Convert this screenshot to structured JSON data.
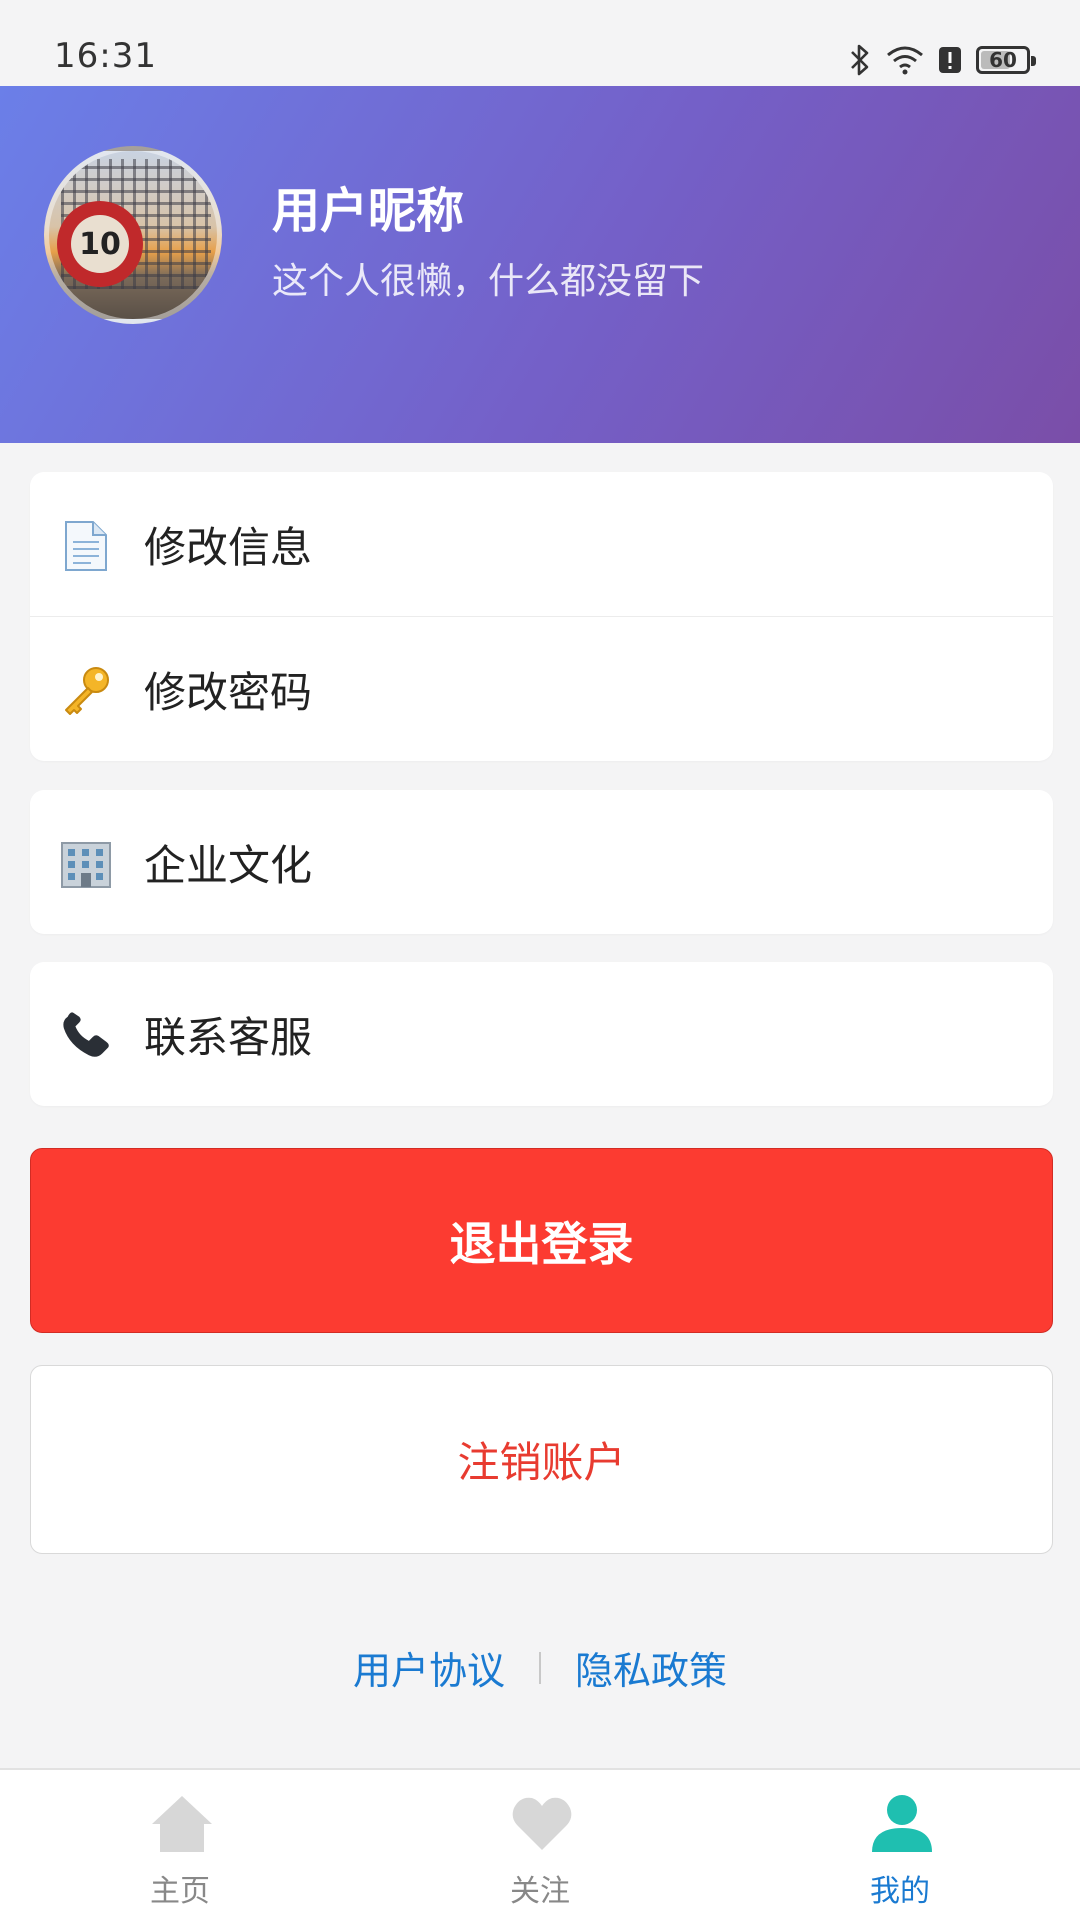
{
  "status_bar": {
    "time": "16:31",
    "battery": "60"
  },
  "profile": {
    "nickname": "用户昵称",
    "bio": "这个人很懒，什么都没留下",
    "avatar_sign_text": "10"
  },
  "menu": {
    "group1": [
      {
        "label": "修改信息",
        "icon": "document-icon"
      },
      {
        "label": "修改密码",
        "icon": "key-icon"
      }
    ],
    "group2": [
      {
        "label": "企业文化",
        "icon": "building-icon"
      }
    ],
    "group3": [
      {
        "label": "联系客服",
        "icon": "phone-icon"
      }
    ]
  },
  "actions": {
    "logout": "退出登录",
    "cancel_account": "注销账户"
  },
  "legal": {
    "user_agreement": "用户协议",
    "privacy_policy": "隐私政策"
  },
  "tabbar": {
    "tabs": [
      {
        "label": "主页",
        "icon": "home-icon",
        "active": false
      },
      {
        "label": "关注",
        "icon": "heart-icon",
        "active": false
      },
      {
        "label": "我的",
        "icon": "person-icon",
        "active": true
      }
    ]
  },
  "colors": {
    "header_start": "#6b7fe8",
    "header_end": "#7a4ea8",
    "logout_bg": "#fc3b31",
    "danger_text": "#e83b30",
    "link": "#1a7ad1",
    "active_tab_icon": "#1fbfb0"
  }
}
